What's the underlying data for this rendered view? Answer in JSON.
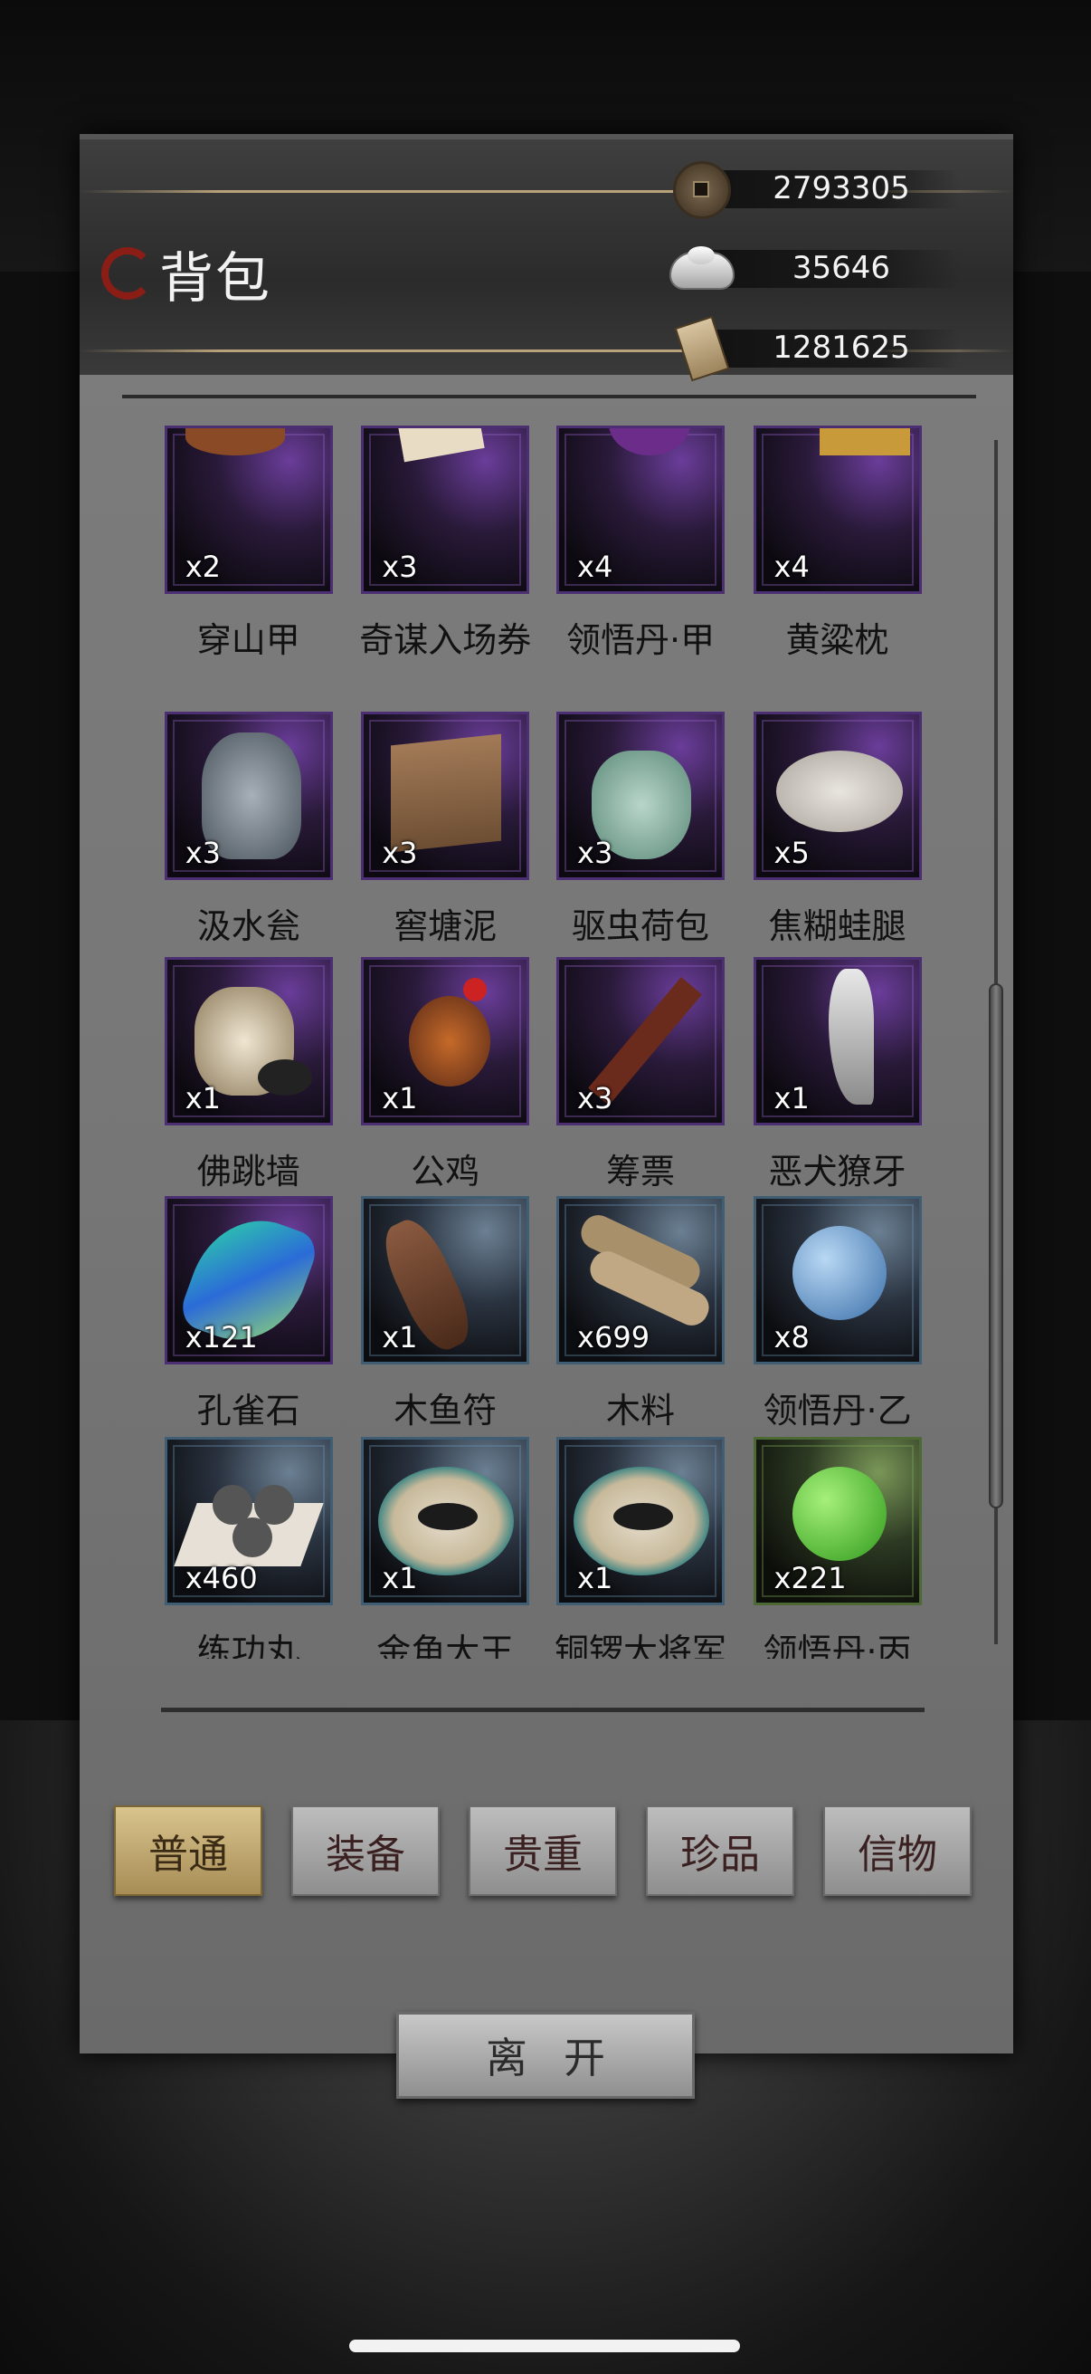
{
  "header": {
    "title": "背包",
    "currencies": [
      {
        "icon": "copper-coin-icon",
        "value": "2793305"
      },
      {
        "icon": "silver-ingot-icon",
        "value": "35646"
      },
      {
        "icon": "scroll-ticket-icon",
        "value": "1281625"
      }
    ]
  },
  "inventory": {
    "rows": [
      [
        {
          "name": "穿山甲",
          "qty": "x2",
          "rarity": "purple",
          "icon": "pangolin-armor-icon"
        },
        {
          "name": "奇谋入场券",
          "qty": "x3",
          "rarity": "purple",
          "icon": "ticket-paper-icon"
        },
        {
          "name": "领悟丹·甲",
          "qty": "x4",
          "rarity": "purple",
          "icon": "purple-pill-icon"
        },
        {
          "name": "黄粱枕",
          "qty": "x4",
          "rarity": "purple",
          "icon": "pillow-icon"
        }
      ],
      [
        {
          "name": "汲水瓮",
          "qty": "x3",
          "rarity": "purple",
          "icon": "water-jar-icon"
        },
        {
          "name": "窖塘泥",
          "qty": "x3",
          "rarity": "purple",
          "icon": "mud-block-icon"
        },
        {
          "name": "驱虫荷包",
          "qty": "x3",
          "rarity": "purple",
          "icon": "pouch-icon"
        },
        {
          "name": "焦糊蛙腿",
          "qty": "x5",
          "rarity": "purple",
          "icon": "frog-leg-plate-icon"
        }
      ],
      [
        {
          "name": "佛跳墙",
          "qty": "x1",
          "rarity": "purple",
          "icon": "soup-pot-icon"
        },
        {
          "name": "公鸡",
          "qty": "x1",
          "rarity": "purple",
          "icon": "rooster-icon"
        },
        {
          "name": "筹票",
          "qty": "x3",
          "rarity": "purple",
          "icon": "bamboo-slip-icon"
        },
        {
          "name": "恶犬獠牙",
          "qty": "x1",
          "rarity": "purple",
          "icon": "fang-icon"
        }
      ],
      [
        {
          "name": "孔雀石",
          "qty": "x121",
          "rarity": "purple",
          "icon": "malachite-icon"
        },
        {
          "name": "木鱼符",
          "qty": "x1",
          "rarity": "blue",
          "icon": "wooden-fish-icon"
        },
        {
          "name": "木料",
          "qty": "x699",
          "rarity": "blue",
          "icon": "wood-logs-icon"
        },
        {
          "name": "领悟丹·乙",
          "qty": "x8",
          "rarity": "blue",
          "icon": "blue-pill-icon"
        }
      ],
      [
        {
          "name": "练功丸",
          "qty": "x460",
          "rarity": "blue",
          "icon": "iron-pills-icon"
        },
        {
          "name": "金角大王",
          "qty": "x1",
          "rarity": "blue",
          "icon": "cricket-bowl-icon"
        },
        {
          "name": "铜锣大将军",
          "qty": "x1",
          "rarity": "blue",
          "icon": "cricket-bowl-icon"
        },
        {
          "name": "领悟丹·丙",
          "qty": "x221",
          "rarity": "green",
          "icon": "green-pill-icon"
        }
      ],
      [
        {
          "name": "",
          "qty": "",
          "rarity": "green",
          "icon": "gourd-icon"
        },
        {
          "name": "",
          "qty": "",
          "rarity": "grey",
          "icon": "cloth-bundle-icon"
        },
        {
          "name": "",
          "qty": "",
          "rarity": "grey",
          "icon": "cloth-bundle-icon"
        },
        {
          "name": "",
          "qty": "",
          "rarity": "grey",
          "icon": "grey-pill-icon"
        }
      ]
    ]
  },
  "tabs": [
    {
      "label": "普通",
      "active": true
    },
    {
      "label": "装备",
      "active": false
    },
    {
      "label": "贵重",
      "active": false
    },
    {
      "label": "珍品",
      "active": false
    },
    {
      "label": "信物",
      "active": false
    }
  ],
  "leave_label": "离开",
  "scroll": {
    "position": 0.45
  },
  "colors": {
    "active_tab": "#d9c48e",
    "purple_frame": "#4c2e73",
    "blue_frame": "#3f5d73",
    "green_frame": "#4d6a35"
  }
}
